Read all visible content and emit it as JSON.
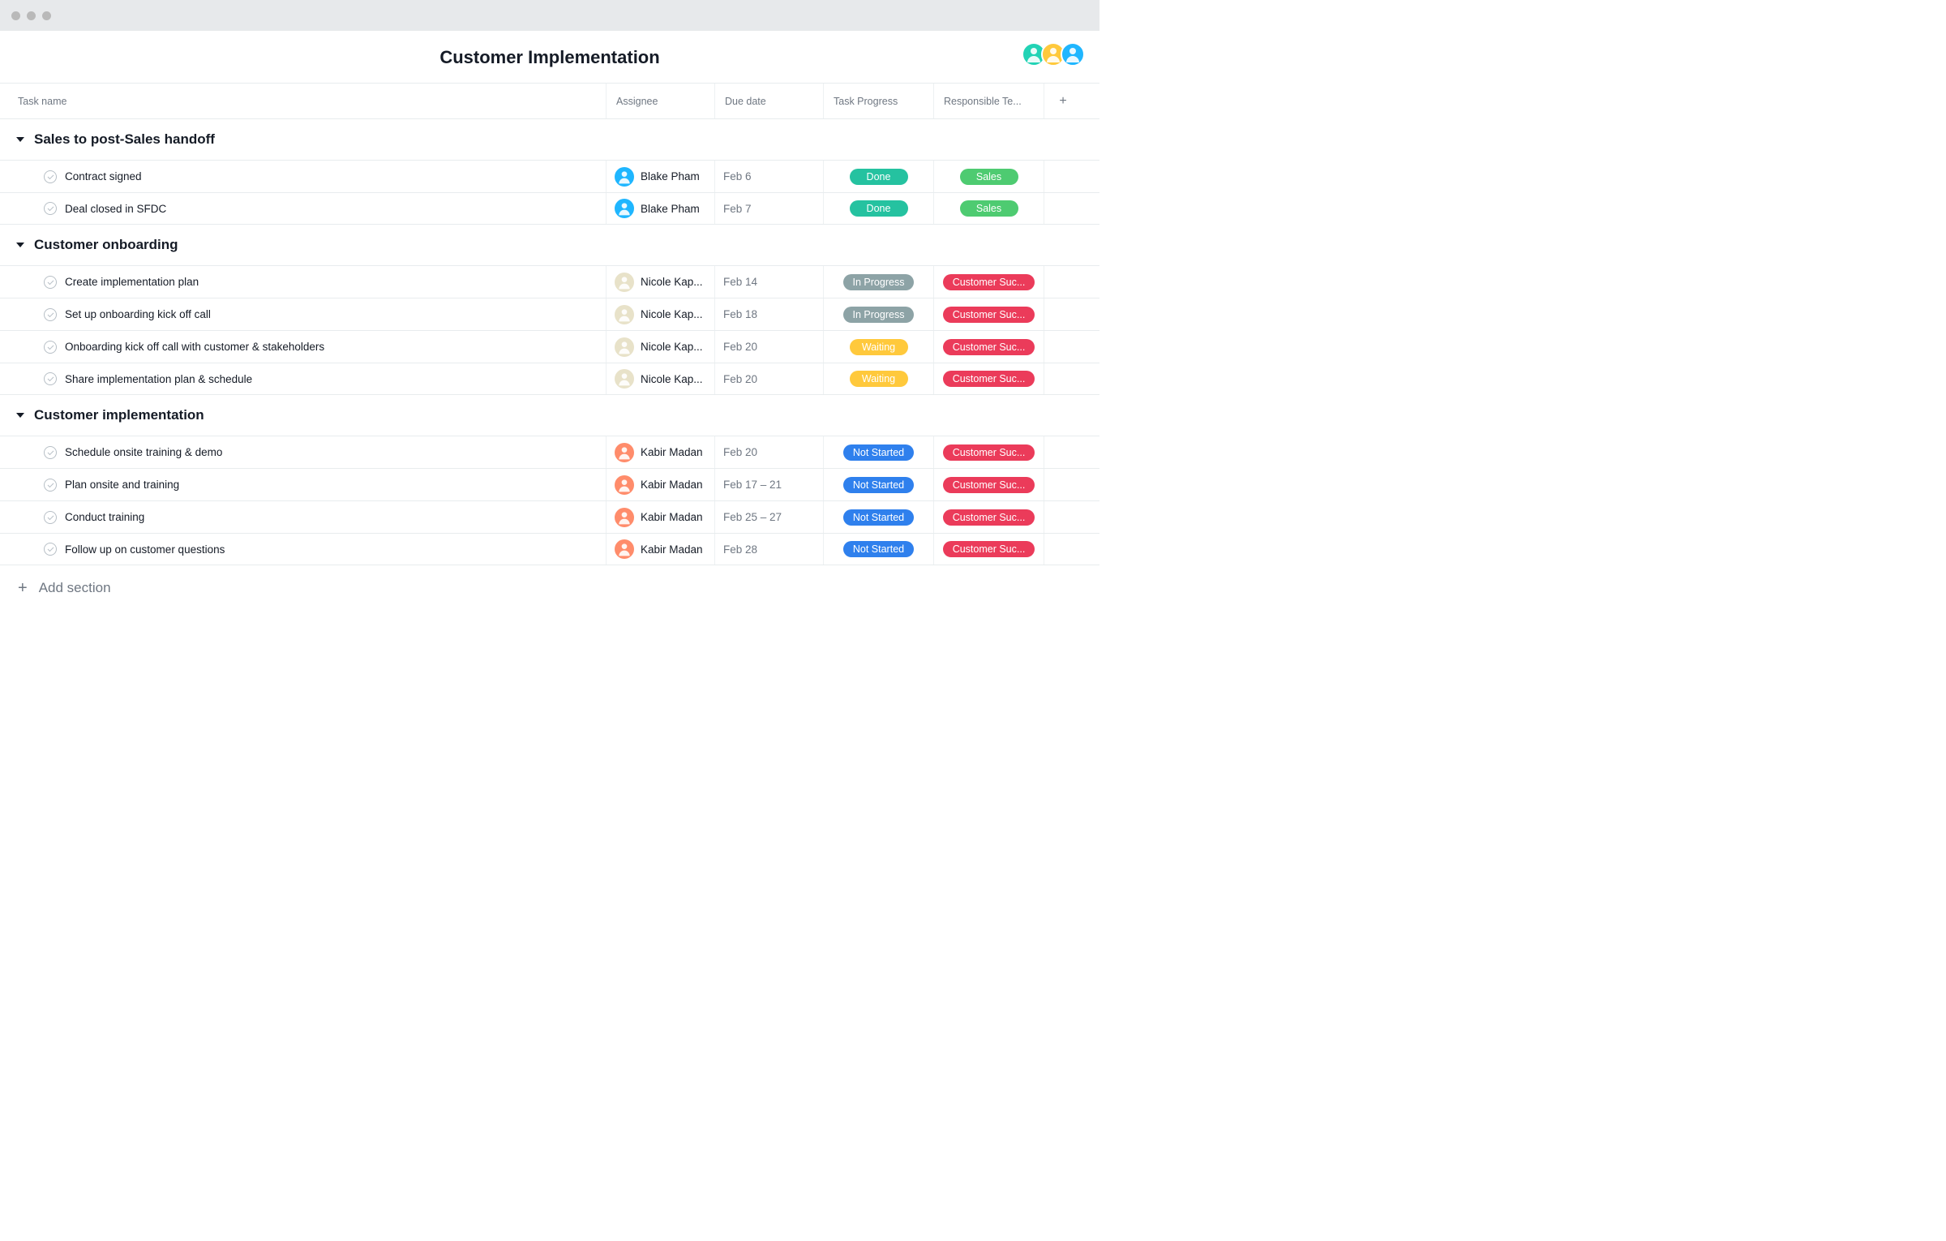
{
  "header": {
    "title": "Customer Implementation"
  },
  "collaborators": [
    {
      "bg": "#22d3b5"
    },
    {
      "bg": "#ffc93c"
    },
    {
      "bg": "#1fb6ff"
    }
  ],
  "columns": {
    "task_name": "Task name",
    "assignee": "Assignee",
    "due_date": "Due date",
    "task_progress": "Task Progress",
    "responsible_team": "Responsible Te..."
  },
  "progress_colors": {
    "Done": "#25c2a0",
    "In Progress": "#8da3a6",
    "Waiting": "#ffc93c",
    "Not Started": "#2f80ed"
  },
  "team_colors": {
    "Sales": "#4ecb71",
    "Customer Suc...": "#eb3b5a"
  },
  "assignee_colors": {
    "Blake Pham": "#1fb6ff",
    "Nicole Kap...": "#e8e2c9",
    "Kabir Madan": "#ff8c6b"
  },
  "sections": [
    {
      "title": "Sales to post-Sales handoff",
      "tasks": [
        {
          "name": "Contract signed",
          "assignee": "Blake Pham",
          "due": "Feb 6",
          "progress": "Done",
          "team": "Sales"
        },
        {
          "name": "Deal closed in SFDC",
          "assignee": "Blake Pham",
          "due": "Feb 7",
          "progress": "Done",
          "team": "Sales"
        }
      ]
    },
    {
      "title": "Customer onboarding",
      "tasks": [
        {
          "name": "Create implementation plan",
          "assignee": "Nicole Kap...",
          "due": "Feb 14",
          "progress": "In Progress",
          "team": "Customer Suc..."
        },
        {
          "name": "Set up onboarding kick off call",
          "assignee": "Nicole Kap...",
          "due": "Feb 18",
          "progress": "In Progress",
          "team": "Customer Suc..."
        },
        {
          "name": "Onboarding kick off call with customer & stakeholders",
          "assignee": "Nicole Kap...",
          "due": "Feb 20",
          "progress": "Waiting",
          "team": "Customer Suc..."
        },
        {
          "name": "Share implementation plan & schedule",
          "assignee": "Nicole Kap...",
          "due": "Feb 20",
          "progress": "Waiting",
          "team": "Customer Suc..."
        }
      ]
    },
    {
      "title": "Customer implementation",
      "tasks": [
        {
          "name": "Schedule onsite training & demo",
          "assignee": "Kabir Madan",
          "due": "Feb 20",
          "progress": "Not Started",
          "team": "Customer Suc..."
        },
        {
          "name": "Plan onsite and training",
          "assignee": "Kabir Madan",
          "due": "Feb 17 – 21",
          "progress": "Not Started",
          "team": "Customer Suc..."
        },
        {
          "name": "Conduct training",
          "assignee": "Kabir Madan",
          "due": "Feb 25 – 27",
          "progress": "Not Started",
          "team": "Customer Suc..."
        },
        {
          "name": "Follow up on customer questions",
          "assignee": "Kabir Madan",
          "due": "Feb 28",
          "progress": "Not Started",
          "team": "Customer Suc..."
        }
      ]
    }
  ],
  "add_section_label": "Add section"
}
